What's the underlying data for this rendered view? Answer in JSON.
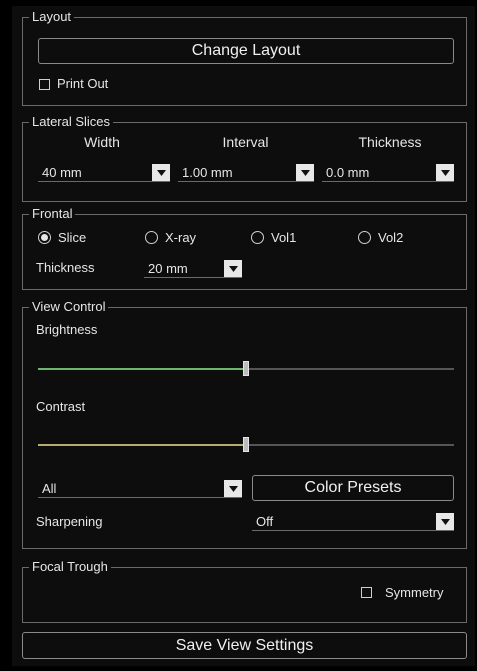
{
  "layout": {
    "legend": "Layout",
    "change_layout_label": "Change Layout",
    "print_out_label": "Print Out",
    "print_out_checked": false
  },
  "lateral_slices": {
    "legend": "Lateral Slices",
    "width_label": "Width",
    "interval_label": "Interval",
    "thickness_label": "Thickness",
    "width_value": "40 mm",
    "interval_value": "1.00 mm",
    "thickness_value": "0.0 mm"
  },
  "frontal": {
    "legend": "Frontal",
    "options": [
      "Slice",
      "X-ray",
      "Vol1",
      "Vol2"
    ],
    "selected": "Slice",
    "thickness_label": "Thickness",
    "thickness_value": "20 mm"
  },
  "view_control": {
    "legend": "View Control",
    "brightness_label": "Brightness",
    "brightness_level": 0.5,
    "brightness_color": "#6fb46f",
    "contrast_label": "Contrast",
    "contrast_level": 0.5,
    "contrast_color": "#b4ad6f",
    "channel_value": "All",
    "color_presets_label": "Color Presets",
    "sharpening_label": "Sharpening",
    "sharpening_value": "Off"
  },
  "focal_trough": {
    "legend": "Focal Trough",
    "symmetry_label": "Symmetry",
    "symmetry_checked": false
  },
  "save_view_settings_label": "Save View Settings"
}
